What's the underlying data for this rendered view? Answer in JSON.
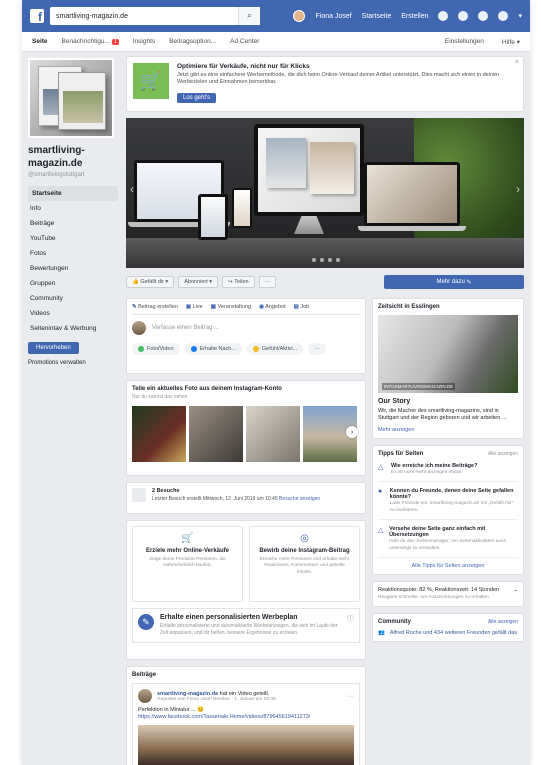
{
  "topbar": {
    "logo": "f",
    "search_value": "smartliving-magazin.de",
    "user": "Fiona Josef",
    "home": "Startseite",
    "create": "Erstellen"
  },
  "pagenav": {
    "tabs": [
      "Seite",
      "Benachrichtigu...",
      "Insights",
      "Beitragsoption...",
      "Ad Center"
    ],
    "badge": "1",
    "settings": "Einstellungen",
    "help": "Hilfe"
  },
  "sidebar": {
    "name": "smartliving-magazin.de",
    "handle": "@smartlivingstuttgart",
    "menu": [
      "Startseite",
      "Info",
      "Beiträge",
      "YouTube",
      "Fotos",
      "Bewertungen",
      "Gruppen",
      "Community",
      "Videos",
      "Seitenintav & Werbung"
    ],
    "promote": "Hervorheben",
    "promo_manage": "Promotions verwalten"
  },
  "banner": {
    "title": "Optimiere für Verkäufe, nicht nur für Klicks",
    "text": "Jetzt gibt es eine einfachere Werbemethode, die dich beim Online-Verkauf deiner Artikel unterstützt. Dies macht sich einen in deinen Werbezielen und Einnahmen bemerkbar.",
    "button": "Los geht's"
  },
  "actions": {
    "liked": "Gefällt dir",
    "subscribed": "Abonniert",
    "share": "Teilen",
    "more": "Mehr dazu"
  },
  "composer": {
    "tabs": [
      "Beitrag erstellen",
      "Live",
      "Veranstaltung",
      "Angebot",
      "Job"
    ],
    "placeholder": "Verfasse einen Beitrag ...",
    "chips": [
      "Foto/Video",
      "Erhalte Nach...",
      "Gefühl/Aktivi..."
    ]
  },
  "instagram": {
    "title": "Teile ein aktuelles Foto aus deinem Instagram-Konto",
    "sub": "Nur du kannst das sehen"
  },
  "visits": {
    "title": "2 Besuche",
    "text": "Letzter Besuch erstellt Mittwoch, 12. Juni 2019 um 10:45",
    "link": "Besuche anzeigen"
  },
  "promos": [
    {
      "title": "Erziele mehr Online-Verkäufe",
      "text": "Zeige deine Produkte Personen, die wahrscheinlich kaufen."
    },
    {
      "title": "Bewirb deine Instagram-Beitrag",
      "text": "Erreiche mehr Personen und erhalte mehr Reaktionen, Kommentare und geteilte Inhalte."
    }
  ],
  "plan": {
    "title": "Erhalte einen personalisierten Werbeplan",
    "text": "Erhalte personalisierte und automatisierte Werbeanzeigen, die sich im Laufe der Zeit anpassen, und dir helfen, bessere Ergebnisse zu erzielen."
  },
  "posts": {
    "title": "Beiträge",
    "author": "smartliving-magazin.de",
    "action": "hat ein Video geteilt.",
    "date": "Gepostet von Fiona Josef Bernber · 1. Januar um 08:48",
    "text": "Perfektion in Miniatur ... 😊",
    "link": "https://www.facebook.com/Tassenale.Home/videos/879645619411273/"
  },
  "right": {
    "time": "Zeitsicht in Esslingen",
    "story_caption": "INTOSMARTLIVINGMAGAZIN.DE",
    "story_title": "Our Story",
    "story_text": "Wir, die Macher des smartliving-magazins, sind in Stuttgart und der Region geboren und wir arbeiten ...",
    "story_link": "Mehr anzeigen",
    "tips_title": "Tipps für Seiten",
    "tips_all": "Alle anzeigen",
    "tips": [
      {
        "title": "Wie erreiche ich meine Beiträge?",
        "text": "Es ist nicht mehr anzeigen etwas."
      },
      {
        "title": "Kennen du Freunde, denen deine Seite gefallen könnte?",
        "text": "Lade Freunde ein, smartliving-magazin.de mit „Gefällt mir“ zu markieren."
      },
      {
        "title": "Versehe deine Seite ganz einfach mit Übersetzungen",
        "text": "Hole dir den Seitenmanager, um Seitenaktivitäten auch unterwegs zu verwalten."
      }
    ],
    "tips_link": "Alle Tipps für Seiten anzeigen",
    "resp_title": "Reaktionsquote: 82 %, Reaktionszeit: 14 Stunden",
    "resp_text": "Reagiere schneller, um Auszeichnungen zu erhalten",
    "community_title": "Community",
    "community_all": "Alle anzeigen",
    "community_text": "Alfred Roche und 434 weiteren Freunden gefällt das"
  }
}
